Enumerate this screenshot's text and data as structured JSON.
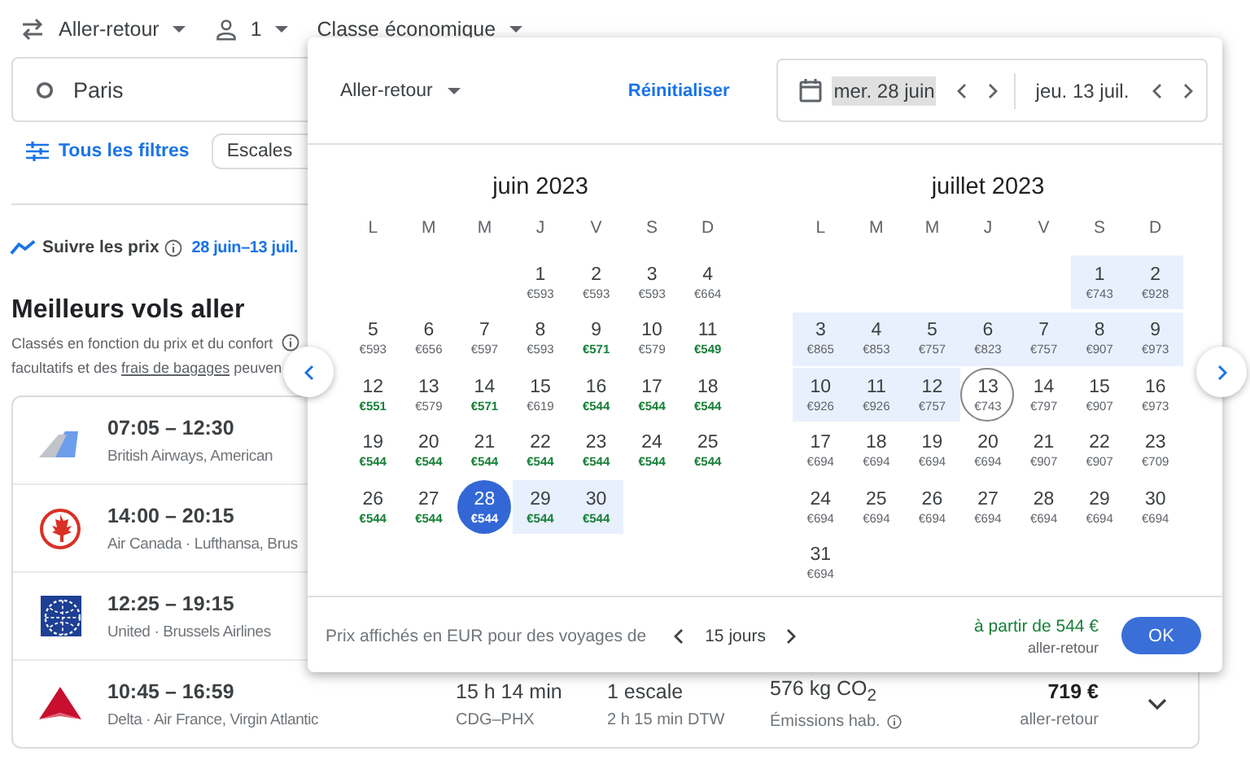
{
  "topbar": {
    "trip_type": "Aller-retour",
    "passengers": "1",
    "cabin_class": "Classe économique"
  },
  "search": {
    "origin": "Paris"
  },
  "filters": {
    "all_filters": "Tous les filtres",
    "chips": [
      "Escales"
    ]
  },
  "price_tracking": {
    "label": "Suivre les prix",
    "dates": "28 juin–13 juil."
  },
  "results": {
    "title": "Meilleurs vols aller",
    "description_1": "Classés en fonction du prix et du confort",
    "description_2_before": "facultatifs et des ",
    "baggage_link": "frais de bagages",
    "description_2_after": " peuven"
  },
  "flights": [
    {
      "times": "07:05 – 12:30",
      "airlines": "British Airways, American"
    },
    {
      "times": "14:00 – 20:15",
      "airlines": "Air Canada · Lufthansa, Brus"
    },
    {
      "times": "12:25 – 19:15",
      "airlines": "United · Brussels Airlines"
    },
    {
      "times": "10:45 – 16:59",
      "airlines": "Delta · Air France, Virgin Atlantic",
      "duration": "15 h 14 min",
      "route": "CDG–PHX",
      "stops": "1 escale",
      "layover": "2 h 15 min DTW",
      "emissions": "576 kg CO$_{2}$",
      "emissions_note": "Émissions hab.",
      "price": "719 €",
      "price_type": "aller-retour"
    }
  ],
  "popup": {
    "trip_type": "Aller-retour",
    "reset": "Réinitialiser",
    "departure": {
      "text": "mer. 28 juin",
      "selected": true
    },
    "return": {
      "text": "jeu. 13 juil.",
      "selected": false
    },
    "months": [
      {
        "title": "juin 2023",
        "weekdays": [
          "L",
          "M",
          "M",
          "J",
          "V",
          "S",
          "D"
        ],
        "days": [
          {
            "kind": "blank"
          },
          {
            "kind": "blank"
          },
          {
            "kind": "blank"
          },
          {
            "kind": "day",
            "day": "1",
            "price": "€593",
            "low_price": false,
            "in_range": false,
            "selected": false
          },
          {
            "kind": "day",
            "day": "2",
            "price": "€593",
            "low_price": false,
            "in_range": false,
            "selected": false
          },
          {
            "kind": "day",
            "day": "3",
            "price": "€593",
            "low_price": false,
            "in_range": false,
            "selected": false
          },
          {
            "kind": "day",
            "day": "4",
            "price": "€664",
            "low_price": false,
            "in_range": false,
            "selected": false
          },
          {
            "kind": "day",
            "day": "5",
            "price": "€593",
            "low_price": false,
            "in_range": false,
            "selected": false
          },
          {
            "kind": "day",
            "day": "6",
            "price": "€656",
            "low_price": false,
            "in_range": false,
            "selected": false
          },
          {
            "kind": "day",
            "day": "7",
            "price": "€597",
            "low_price": false,
            "in_range": false,
            "selected": false
          },
          {
            "kind": "day",
            "day": "8",
            "price": "€593",
            "low_price": false,
            "in_range": false,
            "selected": false
          },
          {
            "kind": "day",
            "day": "9",
            "price": "€571",
            "low_price": true,
            "in_range": false,
            "selected": false
          },
          {
            "kind": "day",
            "day": "10",
            "price": "€579",
            "low_price": false,
            "in_range": false,
            "selected": false
          },
          {
            "kind": "day",
            "day": "11",
            "price": "€549",
            "low_price": true,
            "in_range": false,
            "selected": false
          },
          {
            "kind": "day",
            "day": "12",
            "price": "€551",
            "low_price": true,
            "in_range": false,
            "selected": false
          },
          {
            "kind": "day",
            "day": "13",
            "price": "€579",
            "low_price": false,
            "in_range": false,
            "selected": false
          },
          {
            "kind": "day",
            "day": "14",
            "price": "€571",
            "low_price": true,
            "in_range": false,
            "selected": false
          },
          {
            "kind": "day",
            "day": "15",
            "price": "€619",
            "low_price": false,
            "in_range": false,
            "selected": false
          },
          {
            "kind": "day",
            "day": "16",
            "price": "€544",
            "low_price": true,
            "in_range": false,
            "selected": false
          },
          {
            "kind": "day",
            "day": "17",
            "price": "€544",
            "low_price": true,
            "in_range": false,
            "selected": false
          },
          {
            "kind": "day",
            "day": "18",
            "price": "€544",
            "low_price": true,
            "in_range": false,
            "selected": false
          },
          {
            "kind": "day",
            "day": "19",
            "price": "€544",
            "low_price": true,
            "in_range": false,
            "selected": false
          },
          {
            "kind": "day",
            "day": "20",
            "price": "€544",
            "low_price": true,
            "in_range": false,
            "selected": false
          },
          {
            "kind": "day",
            "day": "21",
            "price": "€544",
            "low_price": true,
            "in_range": false,
            "selected": false
          },
          {
            "kind": "day",
            "day": "22",
            "price": "€544",
            "low_price": true,
            "in_range": false,
            "selected": false
          },
          {
            "kind": "day",
            "day": "23",
            "price": "€544",
            "low_price": true,
            "in_range": false,
            "selected": false
          },
          {
            "kind": "day",
            "day": "24",
            "price": "€544",
            "low_price": true,
            "in_range": false,
            "selected": false
          },
          {
            "kind": "day",
            "day": "25",
            "price": "€544",
            "low_price": true,
            "in_range": false,
            "selected": false
          },
          {
            "kind": "day",
            "day": "26",
            "price": "€544",
            "low_price": true,
            "in_range": false,
            "selected": false
          },
          {
            "kind": "day",
            "day": "27",
            "price": "€544",
            "low_price": true,
            "in_range": false,
            "selected": false
          },
          {
            "kind": "day",
            "day": "28",
            "price": "€544",
            "low_price": true,
            "in_range": false,
            "selected": true
          },
          {
            "kind": "day",
            "day": "29",
            "price": "€544",
            "low_price": true,
            "in_range": true,
            "selected": false
          },
          {
            "kind": "day",
            "day": "30",
            "price": "€544",
            "low_price": true,
            "in_range": true,
            "selected": false
          }
        ]
      },
      {
        "title": "juillet 2023",
        "weekdays": [
          "L",
          "M",
          "M",
          "J",
          "V",
          "S",
          "D"
        ],
        "days": [
          {
            "kind": "blank"
          },
          {
            "kind": "blank"
          },
          {
            "kind": "blank"
          },
          {
            "kind": "blank"
          },
          {
            "kind": "blank"
          },
          {
            "kind": "day",
            "day": "1",
            "price": "€743",
            "low_price": false,
            "in_range": true,
            "selected": false
          },
          {
            "kind": "day",
            "day": "2",
            "price": "€928",
            "low_price": false,
            "in_range": true,
            "selected": false
          },
          {
            "kind": "day",
            "day": "3",
            "price": "€865",
            "low_price": false,
            "in_range": true,
            "selected": false
          },
          {
            "kind": "day",
            "day": "4",
            "price": "€853",
            "low_price": false,
            "in_range": true,
            "selected": false
          },
          {
            "kind": "day",
            "day": "5",
            "price": "€757",
            "low_price": false,
            "in_range": true,
            "selected": false
          },
          {
            "kind": "day",
            "day": "6",
            "price": "€823",
            "low_price": false,
            "in_range": true,
            "selected": false
          },
          {
            "kind": "day",
            "day": "7",
            "price": "€757",
            "low_price": false,
            "in_range": true,
            "selected": false
          },
          {
            "kind": "day",
            "day": "8",
            "price": "€907",
            "low_price": false,
            "in_range": true,
            "selected": false
          },
          {
            "kind": "day",
            "day": "9",
            "price": "€973",
            "low_price": false,
            "in_range": true,
            "selected": false
          },
          {
            "kind": "day",
            "day": "10",
            "price": "€926",
            "low_price": false,
            "in_range": true,
            "selected": false
          },
          {
            "kind": "day",
            "day": "11",
            "price": "€926",
            "low_price": false,
            "in_range": true,
            "selected": false
          },
          {
            "kind": "day",
            "day": "12",
            "price": "€757",
            "low_price": false,
            "in_range": true,
            "selected": false
          },
          {
            "kind": "day",
            "day": "13",
            "price": "€743",
            "low_price": false,
            "in_range": false,
            "selected": true
          },
          {
            "kind": "day",
            "day": "14",
            "price": "€797",
            "low_price": false,
            "in_range": false,
            "selected": false
          },
          {
            "kind": "day",
            "day": "15",
            "price": "€907",
            "low_price": false,
            "in_range": false,
            "selected": false
          },
          {
            "kind": "day",
            "day": "16",
            "price": "€973",
            "low_price": false,
            "in_range": false,
            "selected": false
          },
          {
            "kind": "day",
            "day": "17",
            "price": "€694",
            "low_price": false,
            "in_range": false,
            "selected": false
          },
          {
            "kind": "day",
            "day": "18",
            "price": "€694",
            "low_price": false,
            "in_range": false,
            "selected": false
          },
          {
            "kind": "day",
            "day": "19",
            "price": "€694",
            "low_price": false,
            "in_range": false,
            "selected": false
          },
          {
            "kind": "day",
            "day": "20",
            "price": "€694",
            "low_price": false,
            "in_range": false,
            "selected": false
          },
          {
            "kind": "day",
            "day": "21",
            "price": "€907",
            "low_price": false,
            "in_range": false,
            "selected": false
          },
          {
            "kind": "day",
            "day": "22",
            "price": "€907",
            "low_price": false,
            "in_range": false,
            "selected": false
          },
          {
            "kind": "day",
            "day": "23",
            "price": "€709",
            "low_price": false,
            "in_range": false,
            "selected": false
          },
          {
            "kind": "day",
            "day": "24",
            "price": "€694",
            "low_price": false,
            "in_range": false,
            "selected": false
          },
          {
            "kind": "day",
            "day": "25",
            "price": "€694",
            "low_price": false,
            "in_range": false,
            "selected": false
          },
          {
            "kind": "day",
            "day": "26",
            "price": "€694",
            "low_price": false,
            "in_range": false,
            "selected": false
          },
          {
            "kind": "day",
            "day": "27",
            "price": "€694",
            "low_price": false,
            "in_range": false,
            "selected": false
          },
          {
            "kind": "day",
            "day": "28",
            "price": "€694",
            "low_price": false,
            "in_range": false,
            "selected": false
          },
          {
            "kind": "day",
            "day": "29",
            "price": "€694",
            "low_price": false,
            "in_range": false,
            "selected": false
          },
          {
            "kind": "day",
            "day": "30",
            "price": "€694",
            "low_price": false,
            "in_range": false,
            "selected": false
          },
          {
            "kind": "day",
            "day": "31",
            "price": "€694",
            "low_price": false,
            "in_range": false,
            "selected": false
          }
        ]
      }
    ],
    "footer": {
      "note": "Prix affichés en EUR pour des voyages de",
      "duration": "15 jours",
      "from_price": "à partir de 544 €",
      "price_type": "aller-retour",
      "ok": "OK"
    }
  }
}
